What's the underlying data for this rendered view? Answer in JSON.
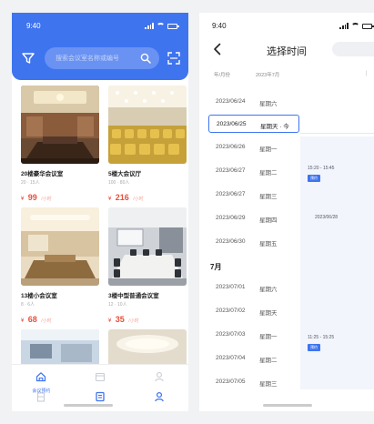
{
  "left_screen": {
    "status_time": "9:40",
    "search_placeholder": "搜索会议室名称或编号",
    "rooms": [
      {
        "name": "20楼豪华会议室",
        "capacity": "20 · 15人",
        "price": "99",
        "currency": "¥",
        "unit": "/小时"
      },
      {
        "name": "5楼大会议厅",
        "capacity": "100 · 80人",
        "price": "216",
        "currency": "¥",
        "unit": "/小时"
      },
      {
        "name": "13楼小会议室",
        "capacity": "8 · 6人",
        "price": "68",
        "currency": "¥",
        "unit": "/小时"
      },
      {
        "name": "3楼中型普通会议室",
        "capacity": "12 · 10人",
        "price": "35",
        "currency": "¥",
        "unit": "/小时"
      }
    ],
    "bottom_nav": {
      "home_label": "会议预约"
    }
  },
  "right_screen": {
    "status_time": "9:40",
    "title": "选择时间",
    "header_col1": "年/月份",
    "header_col2": "2023年7月",
    "header_col3": "|",
    "dates_june": [
      {
        "date": "2023/06/24",
        "weekday": "星期六"
      },
      {
        "date": "2023/06/25",
        "weekday": "星期天 · 今",
        "selected": true
      },
      {
        "date": "2023/06/26",
        "weekday": "星期一"
      },
      {
        "date": "2023/06/27",
        "weekday": "星期二"
      },
      {
        "date": "2023/06/27",
        "weekday": "星期三"
      },
      {
        "date": "2023/06/29",
        "weekday": "星期四"
      },
      {
        "date": "2023/06/30",
        "weekday": "星期五"
      }
    ],
    "month_header": "7月",
    "dates_july": [
      {
        "date": "2023/07/01",
        "weekday": "星期六"
      },
      {
        "date": "2023/07/02",
        "weekday": "星期天"
      },
      {
        "date": "2023/07/03",
        "weekday": "星期一"
      },
      {
        "date": "2023/07/04",
        "weekday": "星期二"
      },
      {
        "date": "2023/07/05",
        "weekday": "星期三"
      }
    ],
    "slots": [
      {
        "time": "15:20 - 15:45",
        "tag": "预约"
      },
      {
        "time": "2023/06/28",
        "tag": ""
      },
      {
        "time": "11:25 - 15:25",
        "tag": "预约"
      }
    ]
  },
  "colors": {
    "accent": "#3f74ef",
    "price": "#e94e3c"
  },
  "icons": [
    "filter-icon",
    "search-icon",
    "scan-icon",
    "back-icon",
    "home-icon",
    "calendar-icon",
    "profile-icon",
    "order-icon"
  ]
}
